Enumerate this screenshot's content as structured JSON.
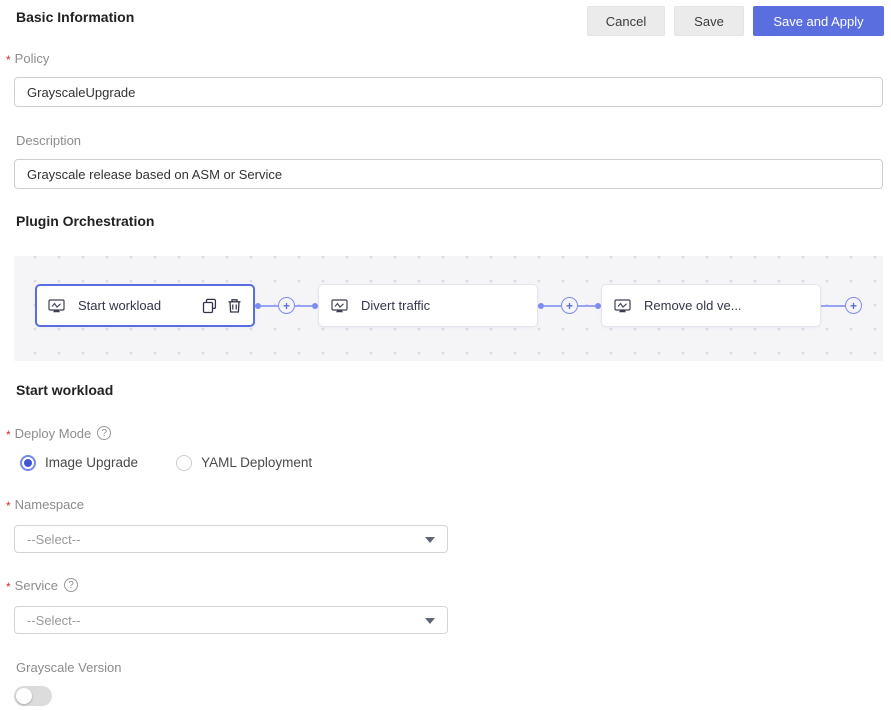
{
  "colors": {
    "primary": "#5A6EE0",
    "connector": "#8D9BF0",
    "canvas_background": "#F5F5F8",
    "required_asterisk": "#E02727"
  },
  "header": {
    "title": "Basic Information",
    "cancel_label": "Cancel",
    "save_label": "Save",
    "save_apply_label": "Save and Apply"
  },
  "basic_form": {
    "policy": {
      "label": "Policy",
      "required": true,
      "value": "GrayscaleUpgrade"
    },
    "description": {
      "label": "Description",
      "required": false,
      "value": "Grayscale release based on ASM or Service"
    }
  },
  "orchestration": {
    "title": "Plugin Orchestration",
    "nodes": [
      {
        "label": "Start workload",
        "selected": true,
        "icon": "workload-monitor-icon",
        "actions": [
          "copy-icon",
          "delete-icon"
        ]
      },
      {
        "label": "Divert traffic",
        "selected": false,
        "icon": "workload-monitor-icon"
      },
      {
        "label": "Remove old ve...",
        "selected": false,
        "icon": "workload-monitor-icon"
      }
    ],
    "add_node_icon": "plus-circle-icon"
  },
  "detail": {
    "title": "Start workload",
    "deploy_mode": {
      "label": "Deploy Mode",
      "required": true,
      "help_icon": "?",
      "options": [
        {
          "label": "Image Upgrade",
          "selected": true
        },
        {
          "label": "YAML Deployment",
          "selected": false
        }
      ]
    },
    "namespace": {
      "label": "Namespace",
      "required": true,
      "selected_value": "--Select--"
    },
    "service": {
      "label": "Service",
      "required": true,
      "help_icon": "?",
      "selected_value": "--Select--"
    },
    "grayscale_version": {
      "label": "Grayscale Version",
      "enabled": false
    }
  }
}
